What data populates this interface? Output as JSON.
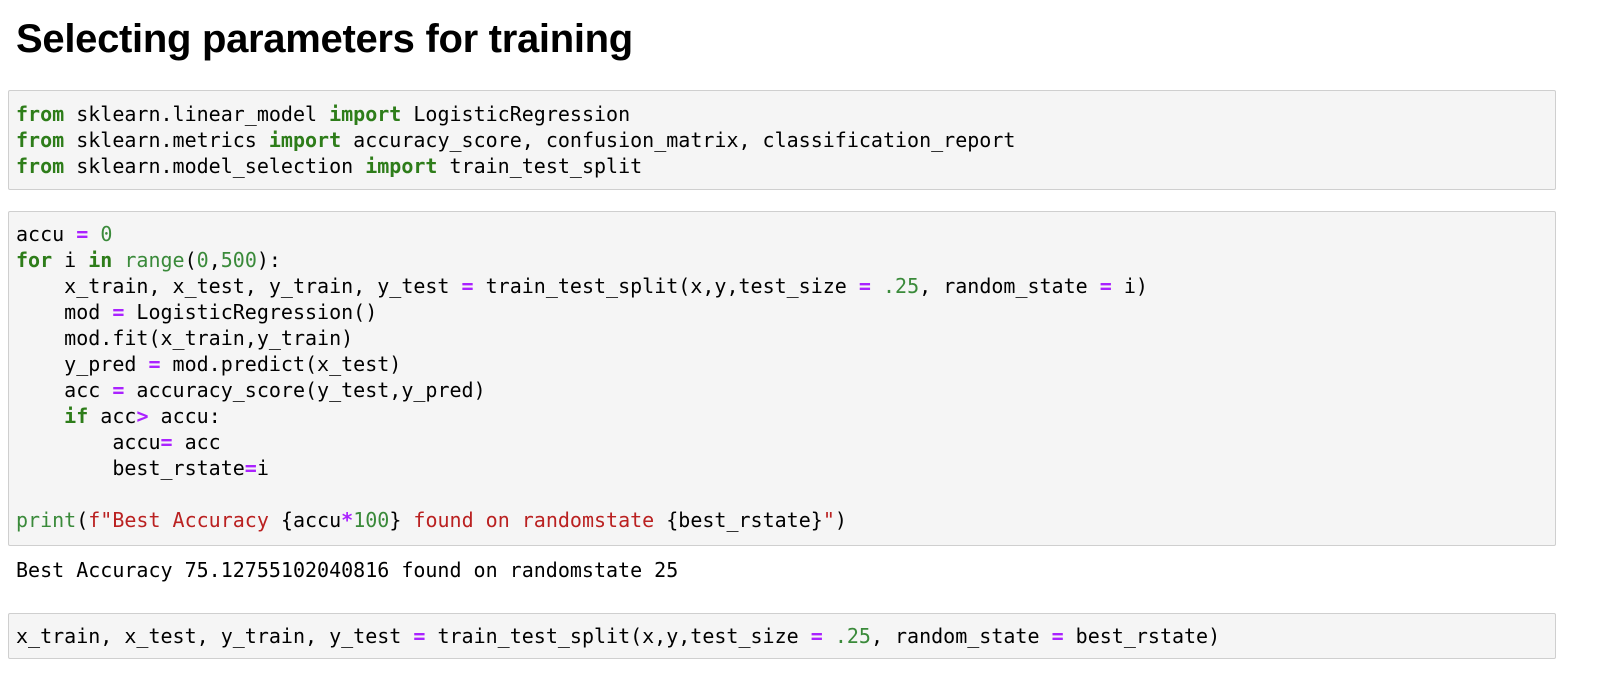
{
  "heading": "Selecting parameters for training",
  "cells": [
    {
      "lines": [
        [
          [
            "kw",
            "from"
          ],
          [
            "t",
            " sklearn.linear_model "
          ],
          [
            "kw",
            "import"
          ],
          [
            "t",
            " LogisticRegression"
          ]
        ],
        [
          [
            "kw",
            "from"
          ],
          [
            "t",
            " sklearn.metrics "
          ],
          [
            "kw",
            "import"
          ],
          [
            "t",
            " accuracy_score, confusion_matrix, classification_report"
          ]
        ],
        [
          [
            "kw",
            "from"
          ],
          [
            "t",
            " sklearn.model_selection "
          ],
          [
            "kw",
            "import"
          ],
          [
            "t",
            " train_test_split"
          ]
        ]
      ]
    },
    {
      "lines": [
        [
          [
            "t",
            "accu "
          ],
          [
            "op",
            "="
          ],
          [
            "t",
            " "
          ],
          [
            "num",
            "0"
          ]
        ],
        [
          [
            "kw",
            "for"
          ],
          [
            "t",
            " i "
          ],
          [
            "kw",
            "in"
          ],
          [
            "t",
            " "
          ],
          [
            "bi",
            "range"
          ],
          [
            "t",
            "("
          ],
          [
            "num",
            "0"
          ],
          [
            "t",
            ","
          ],
          [
            "num",
            "500"
          ],
          [
            "t",
            "):"
          ]
        ],
        [
          [
            "t",
            "    x_train, x_test, y_train, y_test "
          ],
          [
            "op",
            "="
          ],
          [
            "t",
            " train_test_split(x,y,test_size "
          ],
          [
            "op",
            "="
          ],
          [
            "t",
            " "
          ],
          [
            "num",
            ".25"
          ],
          [
            "t",
            ", random_state "
          ],
          [
            "op",
            "="
          ],
          [
            "t",
            " i)"
          ]
        ],
        [
          [
            "t",
            "    mod "
          ],
          [
            "op",
            "="
          ],
          [
            "t",
            " LogisticRegression()"
          ]
        ],
        [
          [
            "t",
            "    mod.fit(x_train,y_train)"
          ]
        ],
        [
          [
            "t",
            "    y_pred "
          ],
          [
            "op",
            "="
          ],
          [
            "t",
            " mod.predict(x_test)"
          ]
        ],
        [
          [
            "t",
            "    acc "
          ],
          [
            "op",
            "="
          ],
          [
            "t",
            " accuracy_score(y_test,y_pred)"
          ]
        ],
        [
          [
            "t",
            "    "
          ],
          [
            "kw",
            "if"
          ],
          [
            "t",
            " acc"
          ],
          [
            "op",
            ">"
          ],
          [
            "t",
            " accu:"
          ]
        ],
        [
          [
            "t",
            "        accu"
          ],
          [
            "op",
            "="
          ],
          [
            "t",
            " acc"
          ]
        ],
        [
          [
            "t",
            "        best_rstate"
          ],
          [
            "op",
            "="
          ],
          [
            "t",
            "i"
          ]
        ],
        [],
        [
          [
            "bi",
            "print"
          ],
          [
            "t",
            "("
          ],
          [
            "str",
            "f\"Best Accuracy "
          ],
          [
            "t",
            "{accu"
          ],
          [
            "op",
            "*"
          ],
          [
            "num",
            "100"
          ],
          [
            "t",
            "}"
          ],
          [
            "str",
            " found on randomstate "
          ],
          [
            "t",
            "{best_rstate}"
          ],
          [
            "str",
            "\""
          ],
          [
            "t",
            ")"
          ]
        ]
      ]
    },
    {
      "lines": [
        [
          [
            "t",
            "x_train, x_test, y_train, y_test "
          ],
          [
            "op",
            "="
          ],
          [
            "t",
            " train_test_split(x,y,test_size "
          ],
          [
            "op",
            "="
          ],
          [
            "t",
            " "
          ],
          [
            "num",
            ".25"
          ],
          [
            "t",
            ", random_state "
          ],
          [
            "op",
            "="
          ],
          [
            "t",
            " best_rstate)"
          ]
        ]
      ]
    }
  ],
  "output": "Best Accuracy 75.12755102040816 found on randomstate 25",
  "colors": {
    "keyword": "#2e7d1a",
    "operator": "#aa22ff",
    "number": "#3a8a3a",
    "builtin": "#3a8a3a",
    "string": "#ba2121",
    "cell_background": "#f5f5f5",
    "cell_border": "#cfcfcf"
  }
}
